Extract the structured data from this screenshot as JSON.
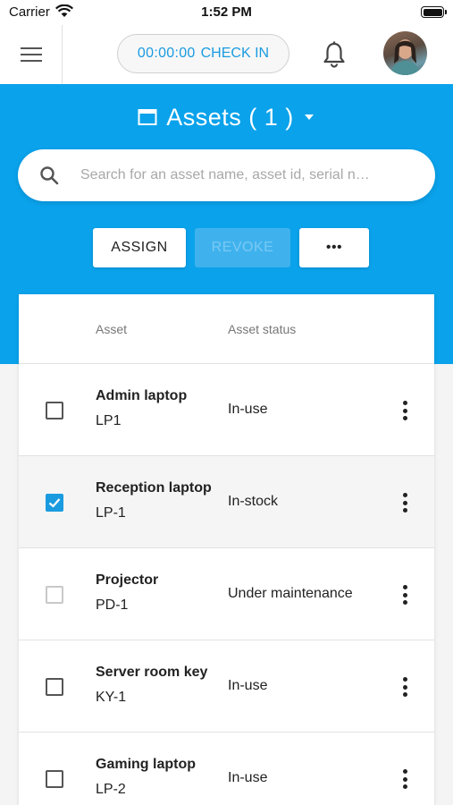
{
  "status_bar": {
    "carrier": "Carrier",
    "time": "1:52 PM"
  },
  "header": {
    "timer": "00:00:00",
    "check_in_label": "CHECK IN"
  },
  "page": {
    "title": "Assets ( 1 )"
  },
  "search": {
    "placeholder": "Search for an asset name, asset id, serial n…"
  },
  "actions": {
    "assign": "ASSIGN",
    "revoke": "REVOKE",
    "more": "•••"
  },
  "table": {
    "headers": {
      "asset": "Asset",
      "status": "Asset status"
    },
    "rows": [
      {
        "name": "Admin laptop",
        "code": "LP1",
        "status": "In-use",
        "checked": false,
        "disabled": false
      },
      {
        "name": "Reception laptop",
        "code": "LP-1",
        "status": "In-stock",
        "checked": true,
        "disabled": false
      },
      {
        "name": "Projector",
        "code": "PD-1",
        "status": "Under maintenance",
        "checked": false,
        "disabled": true
      },
      {
        "name": "Server room key",
        "code": "KY-1",
        "status": "In-use",
        "checked": false,
        "disabled": false
      },
      {
        "name": "Gaming laptop",
        "code": "LP-2",
        "status": "In-use",
        "checked": false,
        "disabled": false
      }
    ]
  },
  "colors": {
    "brand_blue": "#0aa2eb",
    "accent_blue": "#1a9be0"
  },
  "icons": {
    "menu": "hamburger-icon",
    "bell": "bell-icon",
    "search": "search-icon",
    "title": "window-icon",
    "dropdown": "caret-down-icon",
    "row_menu": "kebab-icon"
  }
}
